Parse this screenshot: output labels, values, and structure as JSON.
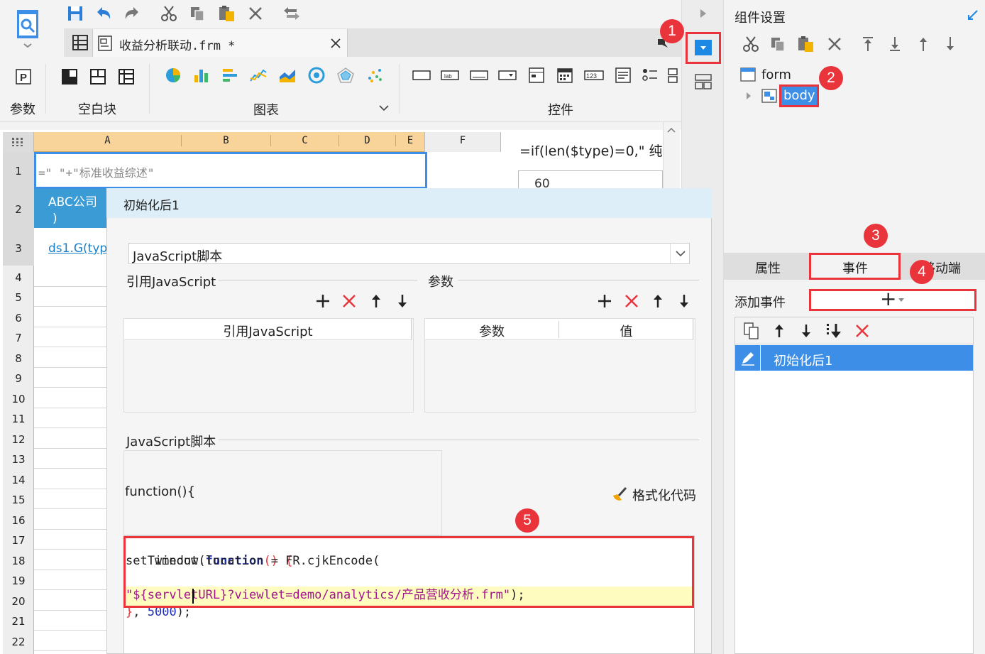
{
  "toolbar": {
    "tab_title": "收益分析联动.frm *"
  },
  "ribbon": {
    "params_label": "参数",
    "blank_label": "空白块",
    "chart_label": "图表",
    "widget_label": "控件"
  },
  "sheet": {
    "columns": [
      "A",
      "B",
      "C",
      "D",
      "E",
      "F"
    ],
    "row_numbers": [
      "1",
      "2",
      "3",
      "4",
      "5",
      "6",
      "7",
      "8",
      "9",
      "10",
      "11",
      "12",
      "13",
      "14",
      "15",
      "16",
      "17",
      "18",
      "19",
      "20",
      "21",
      "22"
    ],
    "cell_a1": "=\" \"+\"标准收益综述\"",
    "cell_a2_line1": "ABC公司",
    "cell_a2_line2": ")",
    "cell_a3": "ds1.G(typ",
    "formula_right": "=if(len($type)=0,\" 纯",
    "value_right": "60"
  },
  "dialog": {
    "title": "初始化后1",
    "type_select": "JavaScript脚本",
    "ref_js_label": "引用JavaScript",
    "params_label": "参数",
    "ref_js_header": "引用JavaScript",
    "params_header": "参数",
    "value_header": "值",
    "js_script_label": "JavaScript脚本",
    "function_header": "function(){",
    "format_code": "格式化代码",
    "code": {
      "l1_a": "setTimeout(",
      "l1_b": "function",
      "l1_c": "() {",
      "l2_a": "    window.location = FR.cjkEncode(",
      "l3_a": "\"${servletURL}?viewlet=demo/analytics/产品营收分析.frm\"",
      "l3_b": ");",
      "l4_a": "}",
      "l4_b": ", ",
      "l4_c": "5000",
      "l4_d": ");"
    }
  },
  "right_panel": {
    "title": "组件设置",
    "tree": {
      "form": "form",
      "body": "body"
    },
    "tabs": [
      "属性",
      "事件",
      "移动端"
    ],
    "add_event_label": "添加事件",
    "add_event_btn": "+",
    "event_item": "初始化后1"
  },
  "markers": [
    "1",
    "2",
    "3",
    "4",
    "5"
  ],
  "colors": {
    "accent": "#1e88e5",
    "selection": "#3d8ee6",
    "highlight_red": "#e8343a",
    "code_bg": "#fefcbf",
    "header_blue": "#3a9bd5"
  }
}
